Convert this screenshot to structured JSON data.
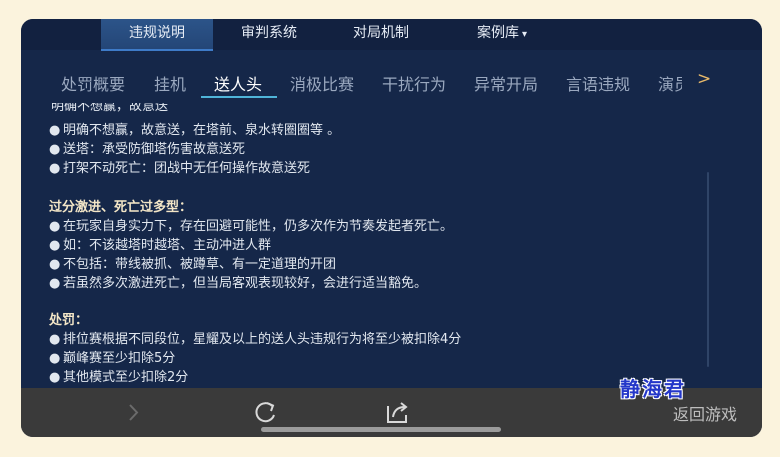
{
  "top_tabs": [
    "违规说明",
    "审判系统",
    "对局机制",
    "案例库"
  ],
  "sub_tabs": [
    "处罚概要",
    "挂机",
    "送人头",
    "消极比赛",
    "干扰行为",
    "异常开局",
    "言语违规",
    "演员"
  ],
  "more_symbol": ">",
  "content": {
    "cut_text": "明确不想赢，故意送",
    "section1_items": [
      "明确不想赢，故意送，在塔前、泉水转圈圈等 。",
      "送塔：承受防御塔伤害故意送死",
      "打架不动死亡：团战中无任何操作故意送死"
    ],
    "section2_title": "过分激进、死亡过多型：",
    "section2_items": [
      "在玩家自身实力下，存在回避可能性，仍多次作为节奏发起者死亡。",
      "如：不该越塔时越塔、主动冲进人群",
      "不包括：带线被抓、被蹲草、有一定道理的开团",
      "若虽然多次激进死亡，但当局客观表现较好，会进行适当豁免。"
    ],
    "section3_title": "处罚：",
    "section3_items": [
      "排位赛根据不同段位，星耀及以上的送人头违规行为将至少被扣除4分",
      "巅峰赛至少扣除5分",
      "其他模式至少扣除2分"
    ]
  },
  "bottom": {
    "return_label": "返回游戏"
  },
  "watermark": "静海君"
}
